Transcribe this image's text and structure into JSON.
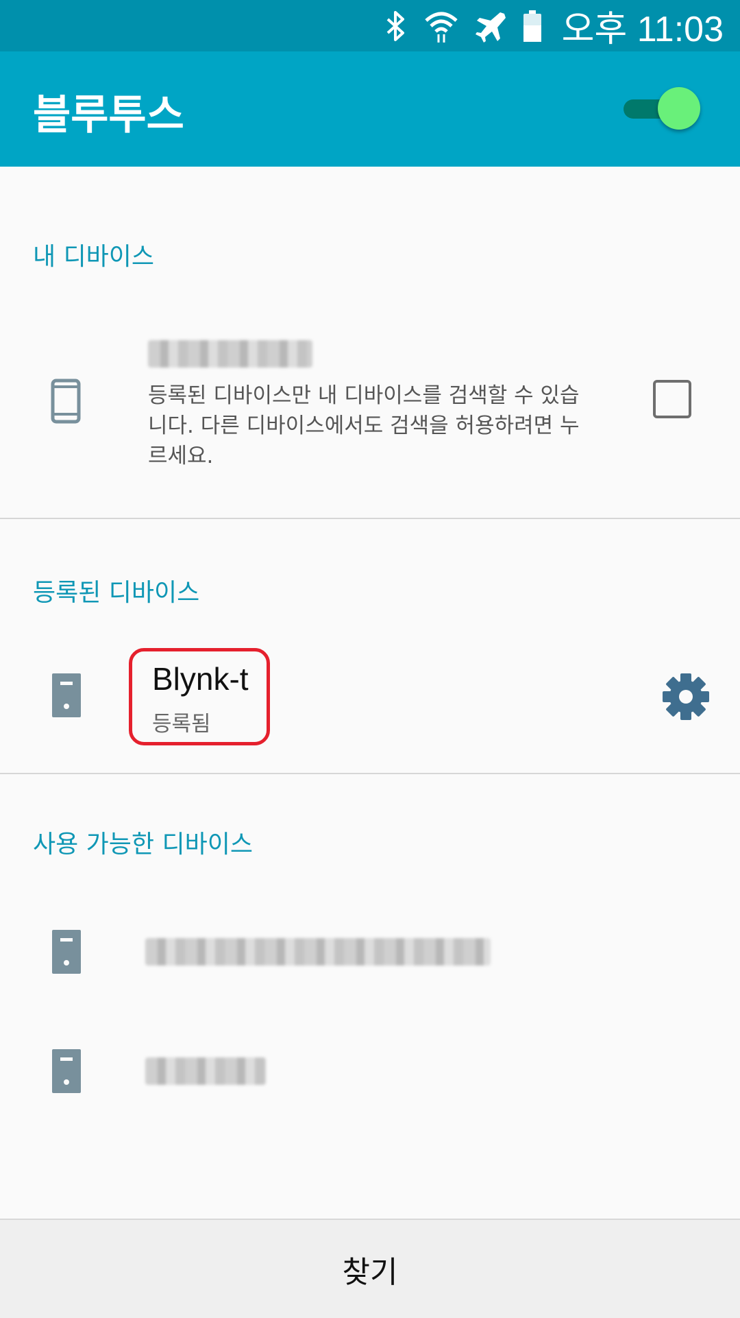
{
  "status_bar": {
    "time": "오후 11:03",
    "icons": [
      "bluetooth-icon",
      "wifi-icon",
      "airplane-icon",
      "battery-icon"
    ]
  },
  "app_bar": {
    "title": "블루투스",
    "bluetooth_enabled": true
  },
  "my_device": {
    "section_title": "내 디바이스",
    "name_hidden": true,
    "description": "등록된 디바이스만 내 디바이스를 검색할 수 있습니다. 다른 디바이스에서도 검색을 허용하려면 누르세요.",
    "visible_to_all": false
  },
  "paired_devices": {
    "section_title": "등록된 디바이스",
    "items": [
      {
        "name": "Blynk-t",
        "status": "등록됨",
        "icon": "device-icon"
      }
    ]
  },
  "available_devices": {
    "section_title": "사용 가능한 디바이스",
    "items": [
      {
        "name_hidden": true,
        "icon": "device-icon"
      },
      {
        "name_hidden": true,
        "icon": "device-icon"
      }
    ]
  },
  "bottom": {
    "scan_label": "찾기"
  },
  "colors": {
    "status_bar": "#0090ac",
    "app_bar": "#00a5c5",
    "accent": "#0f97b5",
    "highlight": "#e5202d",
    "toggle_thumb": "#69f07a"
  }
}
